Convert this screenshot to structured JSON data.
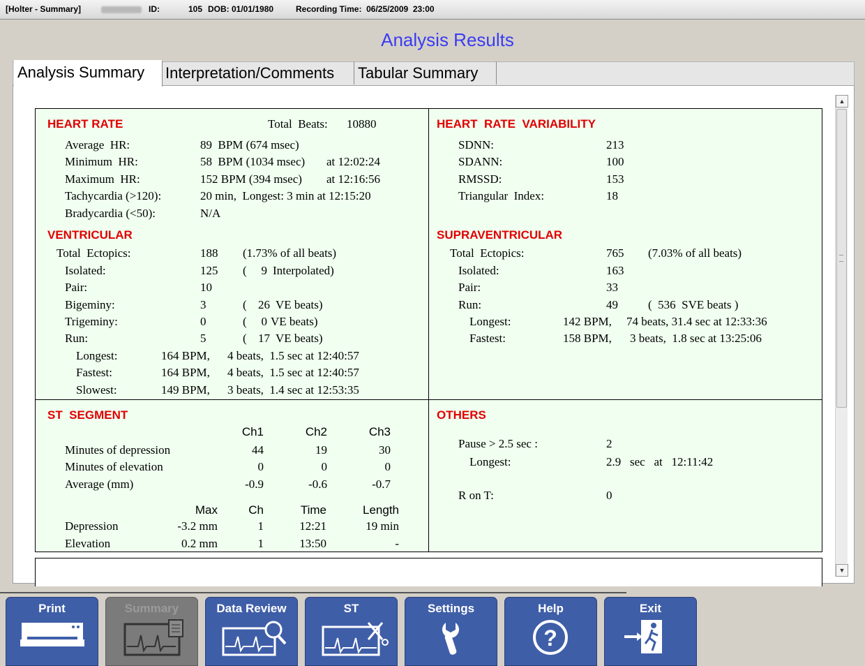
{
  "titlebar": {
    "window": "[Holter - Summary]",
    "id_label": "ID:",
    "id_value": "105",
    "dob": "DOB: 01/01/1980",
    "recording": "Recording Time:  06/25/2009  23:00"
  },
  "app_title": "Analysis Results",
  "tabs": [
    "Analysis Summary",
    "Interpretation/Comments",
    "Tabular Summary"
  ],
  "heart_rate": {
    "title": "HEART RATE",
    "total_beats_label": "Total  Beats:",
    "total_beats": "10880",
    "rows": [
      {
        "label": "Average  HR:",
        "value": "89  BPM (674 msec)",
        "extra": ""
      },
      {
        "label": "Minimum  HR:",
        "value": "58  BPM (1034 msec)",
        "extra": "at 12:02:24"
      },
      {
        "label": "Maximum  HR:",
        "value": "152 BPM (394 msec)",
        "extra": "at 12:16:56"
      },
      {
        "label": "Tachycardia (>120):",
        "value": "20 min,  Longest: 3 min at 12:15:20",
        "extra": ""
      },
      {
        "label": "Bradycardia (<50):",
        "value": "N/A",
        "extra": ""
      }
    ]
  },
  "ventricular": {
    "title": "VENTRICULAR",
    "total_label": "Total  Ectopics:",
    "total": "188",
    "total_pct": "(1.73% of all beats)",
    "rows": [
      {
        "label": "Isolated:",
        "value": "125",
        "open": "(",
        "num": "9",
        "note": "Interpolated)"
      },
      {
        "label": "Pair:",
        "value": "10",
        "open": "",
        "num": "",
        "note": ""
      },
      {
        "label": "Bigeminy:",
        "value": "3",
        "open": "(",
        "num": "26",
        "note": "VE beats)"
      },
      {
        "label": "Trigeminy:",
        "value": "0",
        "open": "(",
        "num": "0",
        "note": "VE beats)"
      },
      {
        "label": "Run:",
        "value": "5",
        "open": "(",
        "num": "17",
        "note": "VE beats)"
      }
    ],
    "runs": [
      {
        "label": "Longest:",
        "bpm": "164 BPM,",
        "detail": "4 beats,  1.5 sec at 12:40:57"
      },
      {
        "label": "Fastest:",
        "bpm": "164 BPM,",
        "detail": "4 beats,  1.5 sec at 12:40:57"
      },
      {
        "label": "Slowest:",
        "bpm": "149 BPM,",
        "detail": "3 beats,  1.4 sec at 12:53:35"
      }
    ]
  },
  "hrv": {
    "title": "HEART  RATE  VARIABILITY",
    "rows": [
      {
        "label": "SDNN:",
        "value": "213"
      },
      {
        "label": "SDANN:",
        "value": "100"
      },
      {
        "label": "RMSSD:",
        "value": "153"
      },
      {
        "label": "Triangular  Index:",
        "value": "18"
      }
    ]
  },
  "supraventricular": {
    "title": "SUPRAVENTRICULAR",
    "total_label": "Total  Ectopics:",
    "total": "765",
    "total_pct": "(7.03% of all beats)",
    "rows": [
      {
        "label": "Isolated:",
        "value": "163",
        "note": ""
      },
      {
        "label": "Pair:",
        "value": "33",
        "note": ""
      },
      {
        "label": "Run:",
        "value": "49",
        "note": "(  536  SVE beats )"
      }
    ],
    "runs": [
      {
        "label": "Longest:",
        "bpm": "142 BPM,",
        "detail": "74 beats, 31.4 sec at 12:33:36"
      },
      {
        "label": "Fastest:",
        "bpm": "158 BPM,",
        "detail": "3 beats,  1.8 sec at 13:25:06"
      }
    ]
  },
  "st_segment": {
    "title": "ST  SEGMENT",
    "channels": [
      "Ch1",
      "Ch2",
      "Ch3"
    ],
    "rows": [
      {
        "label": "Minutes of depression",
        "values": [
          "44",
          "19",
          "30"
        ]
      },
      {
        "label": "Minutes of elevation",
        "values": [
          "0",
          "0",
          "0"
        ]
      },
      {
        "label": "Average (mm)",
        "values": [
          "-0.9",
          "-0.6",
          "-0.7"
        ]
      }
    ],
    "ext_headers": [
      "Max",
      "Ch",
      "Time",
      "Length"
    ],
    "ext_rows": [
      {
        "label": "Depression",
        "max": "-3.2 mm",
        "ch": "1",
        "time": "12:21",
        "length": "19 min"
      },
      {
        "label": "Elevation",
        "max": "0.2 mm",
        "ch": "1",
        "time": "13:50",
        "length": "-"
      }
    ]
  },
  "others": {
    "title": "OTHERS",
    "pause_label": "Pause > 2.5 sec :",
    "pause_value": "2",
    "longest_label": "Longest:",
    "longest_value": "2.9   sec   at   12:11:42",
    "ront_label": "R on T:",
    "ront_value": "0"
  },
  "nav": [
    {
      "label": "Print",
      "icon": "printer-icon",
      "enabled": true
    },
    {
      "label": "Summary",
      "icon": "summary-ecg-icon",
      "enabled": false
    },
    {
      "label": "Data Review",
      "icon": "ecg-magnifier-icon",
      "enabled": true
    },
    {
      "label": "ST",
      "icon": "ecg-scissors-icon",
      "enabled": true
    },
    {
      "label": "Settings",
      "icon": "wrench-icon",
      "enabled": true
    },
    {
      "label": "Help",
      "icon": "help-icon",
      "enabled": true
    },
    {
      "label": "Exit",
      "icon": "exit-icon",
      "enabled": true
    }
  ],
  "colors": {
    "accent": "#3f5ea8",
    "title": "#3b3bf3",
    "section_header": "#e00000",
    "panel_bg": "#f0fff0"
  }
}
